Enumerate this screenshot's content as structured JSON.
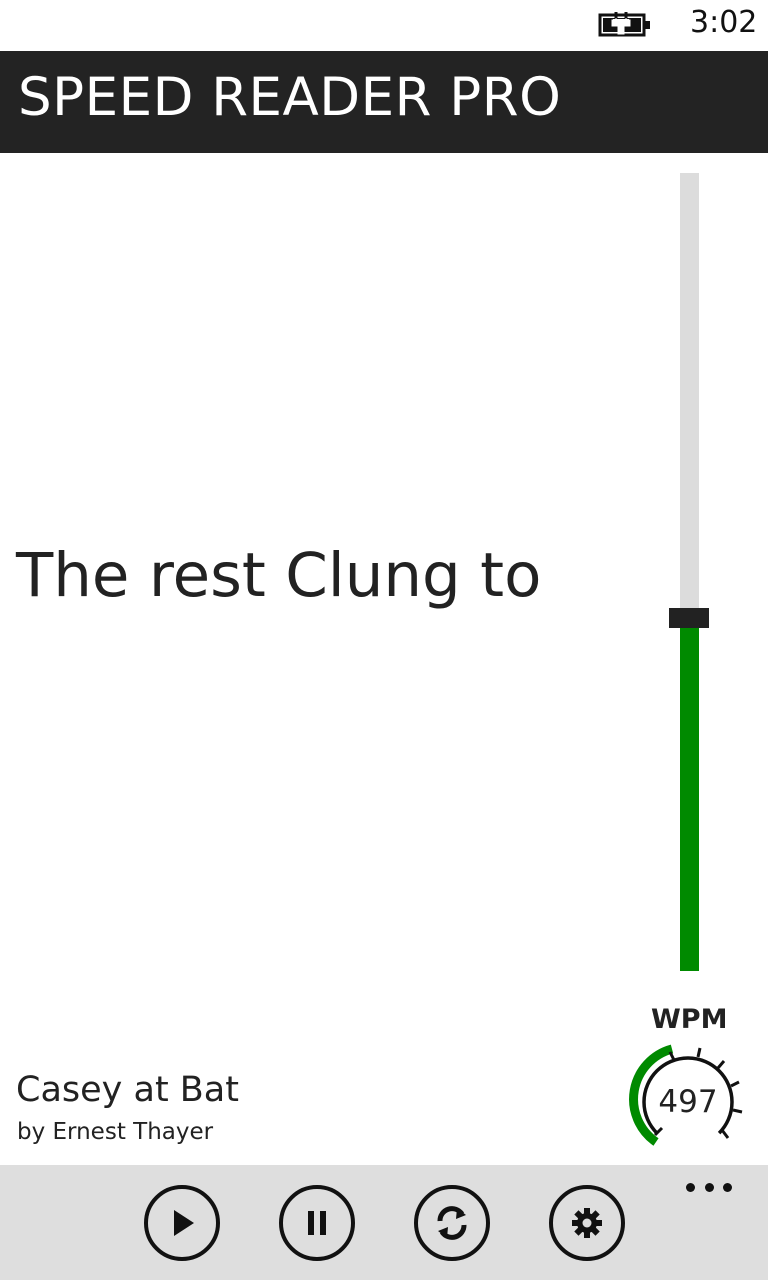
{
  "status_bar": {
    "time": "3:02",
    "battery_icon": "battery-charging-icon"
  },
  "header": {
    "title": "SPEED READER PRO"
  },
  "reader": {
    "current_text": "The rest Clung to"
  },
  "speed_slider": {
    "level_fraction": 0.44,
    "fill_color": "#008a00",
    "track_color": "#dcdcdc"
  },
  "wpm_gauge": {
    "label": "WPM",
    "value": "497",
    "arc_color": "#008a00"
  },
  "book": {
    "title": "Casey at Bat",
    "author": "by Ernest Thayer"
  },
  "app_bar": {
    "buttons": [
      {
        "icon": "play-icon"
      },
      {
        "icon": "pause-icon"
      },
      {
        "icon": "refresh-icon"
      },
      {
        "icon": "settings-gear-icon"
      }
    ],
    "more_icon": "ellipsis-icon"
  }
}
